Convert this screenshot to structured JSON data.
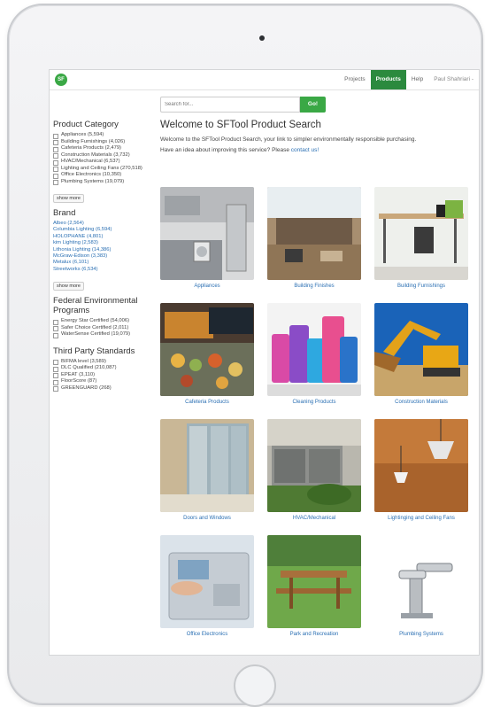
{
  "topnav": {
    "logo_text": "SF",
    "items": [
      {
        "label": "Projects",
        "active": false
      },
      {
        "label": "Products",
        "active": true
      },
      {
        "label": "Help",
        "active": false
      }
    ],
    "user": "Paul Shahriari -"
  },
  "search": {
    "placeholder": "Search for...",
    "button_label": "Go!"
  },
  "sidebar": {
    "category_heading": "Product Category",
    "categories": [
      "Appliances (5,594)",
      "Building Furnishings (4,026)",
      "Cafeteria Products (2,479)",
      "Construction Materials (3,732)",
      "HVAC/Mechanical (6,537)",
      "Lighting and Ceiling Fans (270,518)",
      "Office Electronics (10,350)",
      "Plumbing Systems (19,079)"
    ],
    "show_more_1": "show more",
    "brand_heading": "Brand",
    "brands": [
      "Albeo (2,564)",
      "Columbia Lighting (6,594)",
      "HOLOPHANE (4,801)",
      "kim Lighting (2,583)",
      "Lithonia Lighting (14,386)",
      "McGraw-Edison (3,383)",
      "Metalux (6,101)",
      "Streetworks (6,534)"
    ],
    "show_more_2": "show more",
    "federal_heading": "Federal Environmental Programs",
    "federal": [
      "Energy Star Certified (54,006)",
      "Safer Choice Certified (2,011)",
      "WaterSense Certified (19,079)"
    ],
    "third_party_heading": "Third Party Standards",
    "third_party": [
      "BIFMA level (3,589)",
      "DLC Qualified (210,087)",
      "EPEAT (3,110)",
      "FloorScore (87)",
      "GREENGUARD (268)"
    ]
  },
  "main": {
    "title": "Welcome to SFTool Product Search",
    "intro": "Welcome to the SFTool Product Search, your link to simpler environmentally responsible purchasing.",
    "feedback_prefix": "Have an idea about improving this service? Please ",
    "feedback_link": "contact us!",
    "tiles": [
      {
        "label": "Appliances"
      },
      {
        "label": "Building Finishes"
      },
      {
        "label": "Building Furnishings"
      },
      {
        "label": "Cafeteria Products"
      },
      {
        "label": "Cleaning Products"
      },
      {
        "label": "Construction Materials"
      },
      {
        "label": "Doors and Windows"
      },
      {
        "label": "HVAC/Mechanical"
      },
      {
        "label": "Lightinging and Ceiling Fans"
      },
      {
        "label": "Office Electronics"
      },
      {
        "label": "Park and Recreation"
      },
      {
        "label": "Plumbing Systems"
      }
    ]
  },
  "colors": {
    "brand_green": "#3aa845",
    "nav_active": "#2b8a3e",
    "link_blue": "#2a6fb3"
  }
}
